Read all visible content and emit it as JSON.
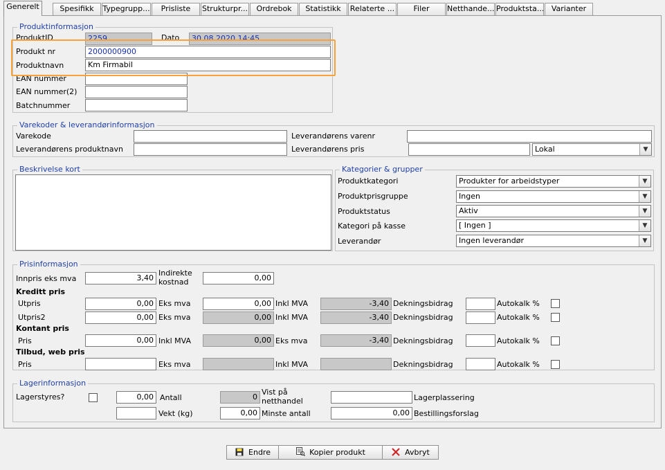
{
  "tabs": [
    "Generelt",
    "Spesifikk",
    "Typegrupp...",
    "Prisliste",
    "Strukturpr...",
    "Ordrebok",
    "Statistikk",
    "Relaterte ...",
    "Filer",
    "Netthande...",
    "Produktsta...",
    "Varianter"
  ],
  "produktinfo": {
    "legend": "Produktinformasjon",
    "produktid_label": "ProduktID",
    "produktid_value": "2259",
    "dato_label": "Dato",
    "dato_value": "30.08.2020 14:45",
    "produktnr_label": "Produkt nr",
    "produktnr_value": "2000000900",
    "produktnavn_label": "Produktnavn",
    "produktnavn_value": "Km Firmabil",
    "ean_label": "EAN nummer",
    "ean_value": "",
    "ean2_label": "EAN nummer(2)",
    "ean2_value": "",
    "batch_label": "Batchnummer",
    "batch_value": ""
  },
  "varekoder": {
    "legend": "Varekoder & leverandørinformasjon",
    "varekode_label": "Varekode",
    "varekode_value": "",
    "levprodnavn_label": "Leverandørens produktnavn",
    "levprodnavn_value": "",
    "levvarenr_label": "Leverandørens varenr",
    "levvarenr_value": "",
    "levpris_label": "Leverandørens pris",
    "levpris_value": "",
    "valuta_value": "Lokal"
  },
  "beskrivelse": {
    "legend": "Beskrivelse kort",
    "value": ""
  },
  "kategorier": {
    "legend": "Kategorier & grupper",
    "rows": [
      {
        "label": "Produktkategori",
        "value": "Produkter for arbeidstyper"
      },
      {
        "label": "Produktprisgruppe",
        "value": "Ingen"
      },
      {
        "label": "Produktstatus",
        "value": "Aktiv"
      },
      {
        "label": "Kategori på kasse",
        "value": "[ Ingen ]"
      },
      {
        "label": "Leverandør",
        "value": "Ingen leverandør"
      }
    ]
  },
  "pris": {
    "legend": "Prisinformasjon",
    "innpris_label": "Innpris eks mva",
    "innpris_value": "3,40",
    "indirekte_label_1": "Indirekte",
    "indirekte_label_2": "kostnad",
    "indirekte_value": "0,00",
    "kreditt_heading": "Kreditt pris",
    "kontant_heading": "Kontant pris",
    "tilbud_heading": "Tilbud, web pris",
    "utpris_label": "Utpris",
    "utpris_value": "0,00",
    "utpris_eks_label": "Eks mva",
    "utpris_eks_value": "0,00",
    "utpris_inkl_label": "Inkl MVA",
    "utpris_inkl_value": "-3,40",
    "utpris_db_label": "Dekningsbidrag",
    "utpris_db_value": "",
    "utpris_auto_label": "Autokalk %",
    "utpris2_label": "Utpris2",
    "utpris2_value": "0,00",
    "utpris2_eks_label": "Eks mva",
    "utpris2_eks_value": "0,00",
    "utpris2_inkl_label": "Inkl MVA",
    "utpris2_inkl_value": "-3,40",
    "utpris2_db_label": "Dekningsbidrag",
    "utpris2_db_value": "",
    "utpris2_auto_label": "Autokalk %",
    "kontant_label": "Pris",
    "kontant_value": "0,00",
    "kontant_inkl_label": "Inkl MVA",
    "kontant_inkl_value": "0,00",
    "kontant_eks_label": "Eks mva",
    "kontant_eks_value": "-3,40",
    "kontant_db_label": "Dekningsbidrag",
    "kontant_db_value": "",
    "kontant_auto_label": "Autokalk %",
    "tilbud_label": "Pris",
    "tilbud_value": "",
    "tilbud_eks_label": "Eks mva",
    "tilbud_eks_value": "",
    "tilbud_inkl_label": "Inkl MVA",
    "tilbud_inkl_value": "",
    "tilbud_db_label": "Dekningsbidrag",
    "tilbud_db_value": "",
    "tilbud_auto_label": "Autokalk %"
  },
  "lager": {
    "legend": "Lagerinformasjon",
    "lagerstyres_label": "Lagerstyres?",
    "antall_input": "0,00",
    "antall_label": "Antall",
    "antall_ro": "0",
    "vist_label_1": "Vist på",
    "vist_label_2": "netthandel",
    "vist_value": "",
    "lagerplassering_label": "Lagerplassering",
    "vekt_value": "",
    "vekt_label": "Vekt (kg)",
    "minste_value": "0,00",
    "minste_label": "Minste antall",
    "bestilling_value": "0,00",
    "bestilling_label": "Bestillingsforslag"
  },
  "buttons": {
    "endre": "Endre",
    "kopier": "Kopier produkt",
    "avbryt": "Avbryt"
  },
  "icons": {
    "endre": "save-icon",
    "kopier": "copy-icon",
    "avbryt": "cancel-icon"
  }
}
